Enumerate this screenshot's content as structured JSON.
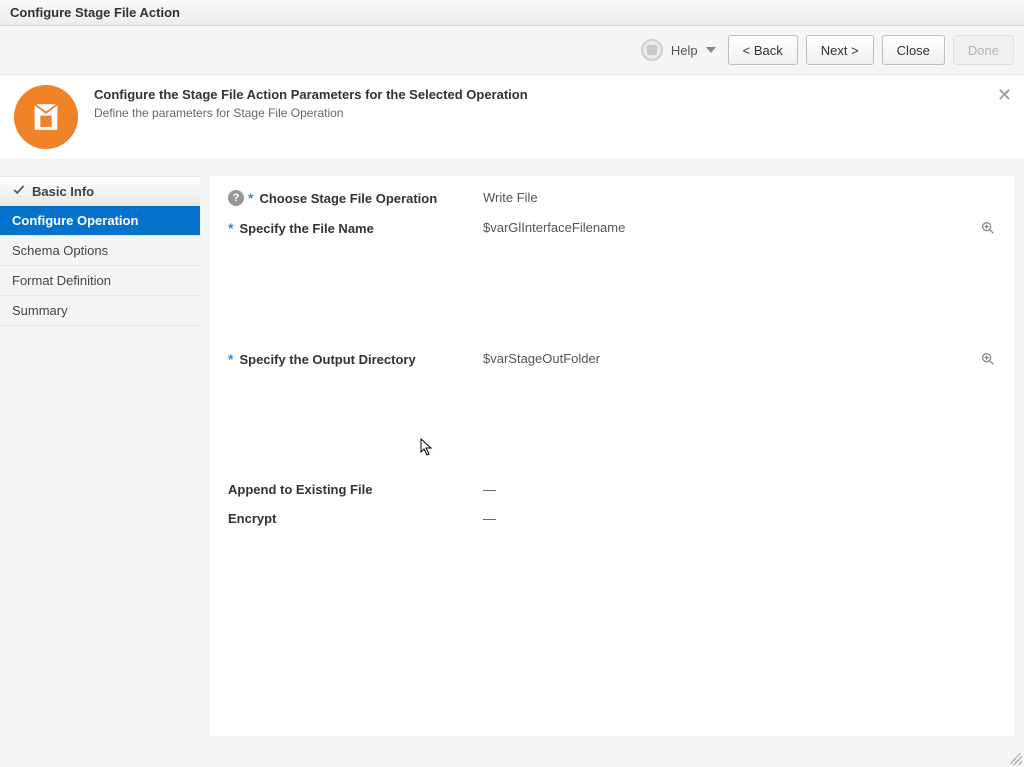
{
  "window": {
    "title": "Configure Stage File Action"
  },
  "toolbar": {
    "help_label": "Help",
    "back": "<  Back",
    "next": "Next  >",
    "close": "Close",
    "done": "Done"
  },
  "banner": {
    "title": "Configure the Stage File Action Parameters for the Selected Operation",
    "subtitle": "Define the parameters for Stage File Operation"
  },
  "sidebar": {
    "items": [
      {
        "label": "Basic Info",
        "completed": true
      },
      {
        "label": "Configure Operation",
        "active": true
      },
      {
        "label": "Schema Options"
      },
      {
        "label": "Format Definition"
      },
      {
        "label": "Summary"
      }
    ]
  },
  "form": {
    "choose_label": "Choose Stage File Operation",
    "choose_value": "Write File",
    "filename_label": "Specify the File Name",
    "filename_value": "$varGlInterfaceFilename",
    "output_label": "Specify the Output Directory",
    "output_value": "$varStageOutFolder",
    "append_label": "Append to Existing File",
    "append_value": "—",
    "encrypt_label": "Encrypt",
    "encrypt_value": "—"
  }
}
